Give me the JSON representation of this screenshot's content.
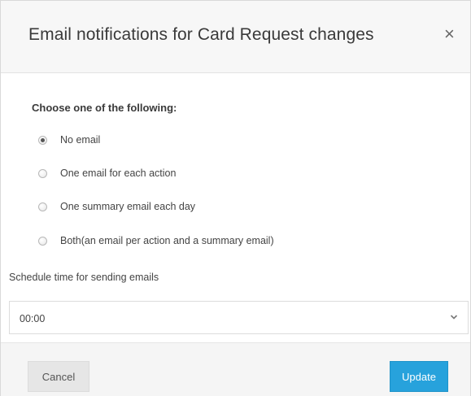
{
  "dialog": {
    "title": "Email notifications for Card Request changes",
    "close_icon": "×"
  },
  "notification_options": {
    "prompt": "Choose one of the following:",
    "options": [
      {
        "label": "No email",
        "selected": true
      },
      {
        "label": "One email for each action",
        "selected": false
      },
      {
        "label": "One summary email each day",
        "selected": false
      },
      {
        "label": "Both(an email per action and a summary email)",
        "selected": false
      }
    ]
  },
  "schedule": {
    "label": "Schedule time for sending emails",
    "selected_value": "00:00"
  },
  "footer": {
    "cancel_label": "Cancel",
    "update_label": "Update"
  },
  "colors": {
    "primary": "#27a2dc",
    "header_bg": "#f7f7f7",
    "footer_bg": "#f5f5f5"
  },
  "icons": {
    "close": "close-icon",
    "dropdown": "chevron-down-icon"
  }
}
